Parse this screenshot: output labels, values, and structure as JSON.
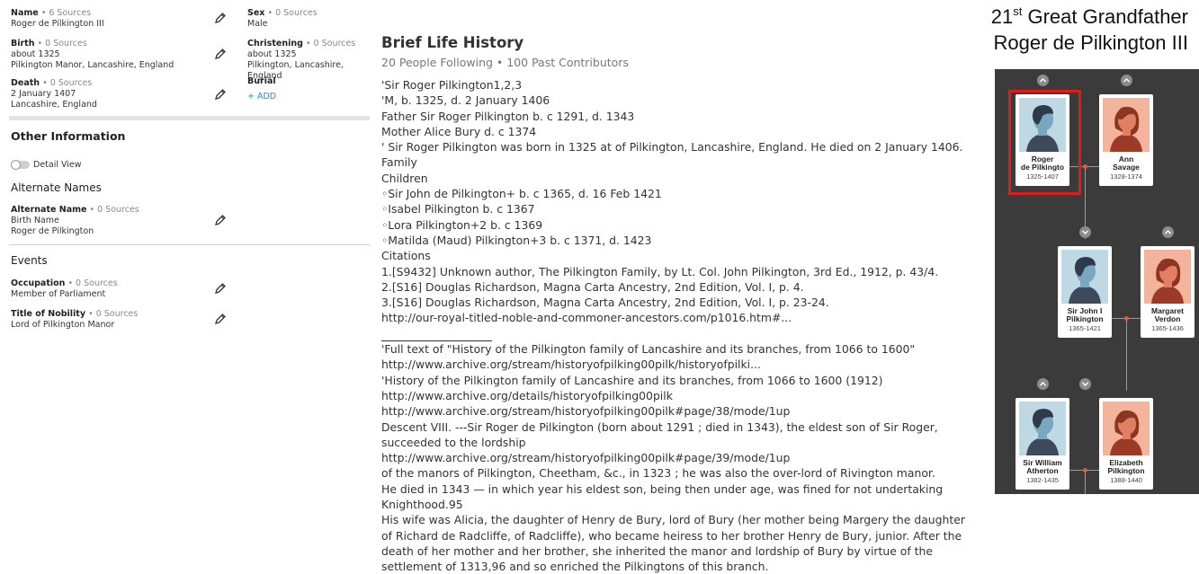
{
  "vitals": {
    "name": {
      "label": "Name",
      "sources": "• 6 Sources",
      "value": "Roger de Pilkington III"
    },
    "sex": {
      "label": "Sex",
      "sources": "• 0 Sources",
      "value": "Male"
    },
    "birth": {
      "label": "Birth",
      "sources": "• 0 Sources",
      "date": "about 1325",
      "place": "Pilkington Manor, Lancashire, England"
    },
    "christening": {
      "label": "Christening",
      "sources": "• 0 Sources",
      "date": "about 1325",
      "place": "Pilkington, Lancashire, England"
    },
    "death": {
      "label": "Death",
      "sources": "• 0 Sources",
      "date": "2 January 1407",
      "place": "Lancashire, England"
    },
    "burial": {
      "label": "Burial",
      "add": "+ ADD"
    }
  },
  "other_info": {
    "title": "Other Information",
    "detail_view": "Detail View",
    "alternate_names_title": "Alternate Names",
    "alt_name": {
      "label": "Alternate Name",
      "sources": "• 0 Sources",
      "type": "Birth Name",
      "value": "Roger de Pilkington"
    },
    "events_title": "Events",
    "occupation": {
      "label": "Occupation",
      "sources": "• 0 Sources",
      "value": "Member of Parliament"
    },
    "nobility": {
      "label": "Title of Nobility",
      "sources": "• 0 Sources",
      "value": "Lord of Pilkington Manor"
    }
  },
  "bio": {
    "title": "Brief Life History",
    "subtitle": "20 People Following • 100 Past Contributors",
    "lines": [
      "'Sir Roger Pilkington1,2,3",
      "'M, b. 1325, d. 2 January 1406",
      "Father Sir Roger Pilkington b. c 1291, d. 1343",
      "Mother Alice Bury d. c 1374",
      "' Sir Roger Pilkington was born in 1325 at of Pilkington, Lancashire, England. He died on 2 January 1406.",
      "Family",
      "Children",
      "◦Sir John de Pilkington+ b. c 1365, d. 16 Feb 1421",
      "◦Isabel Pilkington b. c 1367",
      "◦Lora Pilkington+2 b. c 1369",
      "◦Matilda (Maud) Pilkington+3 b. c 1371, d. 1423",
      "Citations",
      "1.[S9432] Unknown author, The Pilkington Family, by Lt. Col. John Pilkington, 3rd Ed., 1912, p. 43/4.",
      "2.[S16] Douglas Richardson, Magna Carta Ancestry, 2nd Edition, Vol. I, p. 4.",
      "3.[S16] Douglas Richardson, Magna Carta Ancestry, 2nd Edition, Vol. I, p. 23-24.",
      "http://our-royal-titled-noble-and-commoner-ancestors.com/p1016.htm#...",
      "",
      "'Full text of \"History of the Pilkington family of Lancashire and its branches, from 1066 to 1600\"",
      "http://www.archive.org/stream/historyofpilking00pilk/historyofpilki...",
      "'History of the Pilkington family of Lancashire and its branches, from 1066 to 1600 (1912)",
      "http://www.archive.org/details/historyofpilking00pilk",
      "http://www.archive.org/stream/historyofpilking00pilk#page/38/mode/1up",
      "Descent VIII. ---Sir Roger de Pilkington (born about 1291 ; died in 1343), the eldest son of Sir Roger, succeeded to the lordship",
      "http://www.archive.org/stream/historyofpilking00pilk#page/39/mode/1up",
      "of the manors of Pilkington, Cheetham, &c., in 1323 ; he was also the over-lord of Rivington manor.",
      "He died in 1343 — in which year his eldest son, being then under age, was fined for not undertaking Knighthood.95",
      "His wife was Alicia, the daughter of Henry de Bury, lord of Bury (her mother being Margery the daughter of Richard de Radcliffe, of Radcliffe), who became heiress to her brother Henry de Bury, junior. After the death of her mother and her brother, she inherited the manor and lordship of Bury by virtue of the settlement of 1313,96 and so enriched the Pilkingtons of this branch."
    ]
  },
  "caption": {
    "ordinal": "21",
    "suffix": "st",
    "relation": "Great Grandfather",
    "name": "Roger de Pilkington III"
  },
  "tree": {
    "cards": [
      {
        "name1": "Roger",
        "name2": "de Pilkingto",
        "years": "1325-1407",
        "sex": "male"
      },
      {
        "name1": "Ann",
        "name2": "Savage",
        "years": "1328-1374",
        "sex": "female"
      },
      {
        "name1": "Sir John I",
        "name2": "Pilkington",
        "years": "1365-1421",
        "sex": "male"
      },
      {
        "name1": "Margaret",
        "name2": "Verdon",
        "years": "1365-1436",
        "sex": "female"
      },
      {
        "name1": "Sir William",
        "name2": "Atherton",
        "years": "1382-1435",
        "sex": "male"
      },
      {
        "name1": "Elizabeth",
        "name2": "Pilkington",
        "years": "1388-1440",
        "sex": "female"
      }
    ],
    "colors": {
      "male_bg": "#bfd9e4",
      "female_bg": "#f4b49c",
      "highlight": "#e01b1b",
      "panel": "#3b3b3b"
    }
  }
}
